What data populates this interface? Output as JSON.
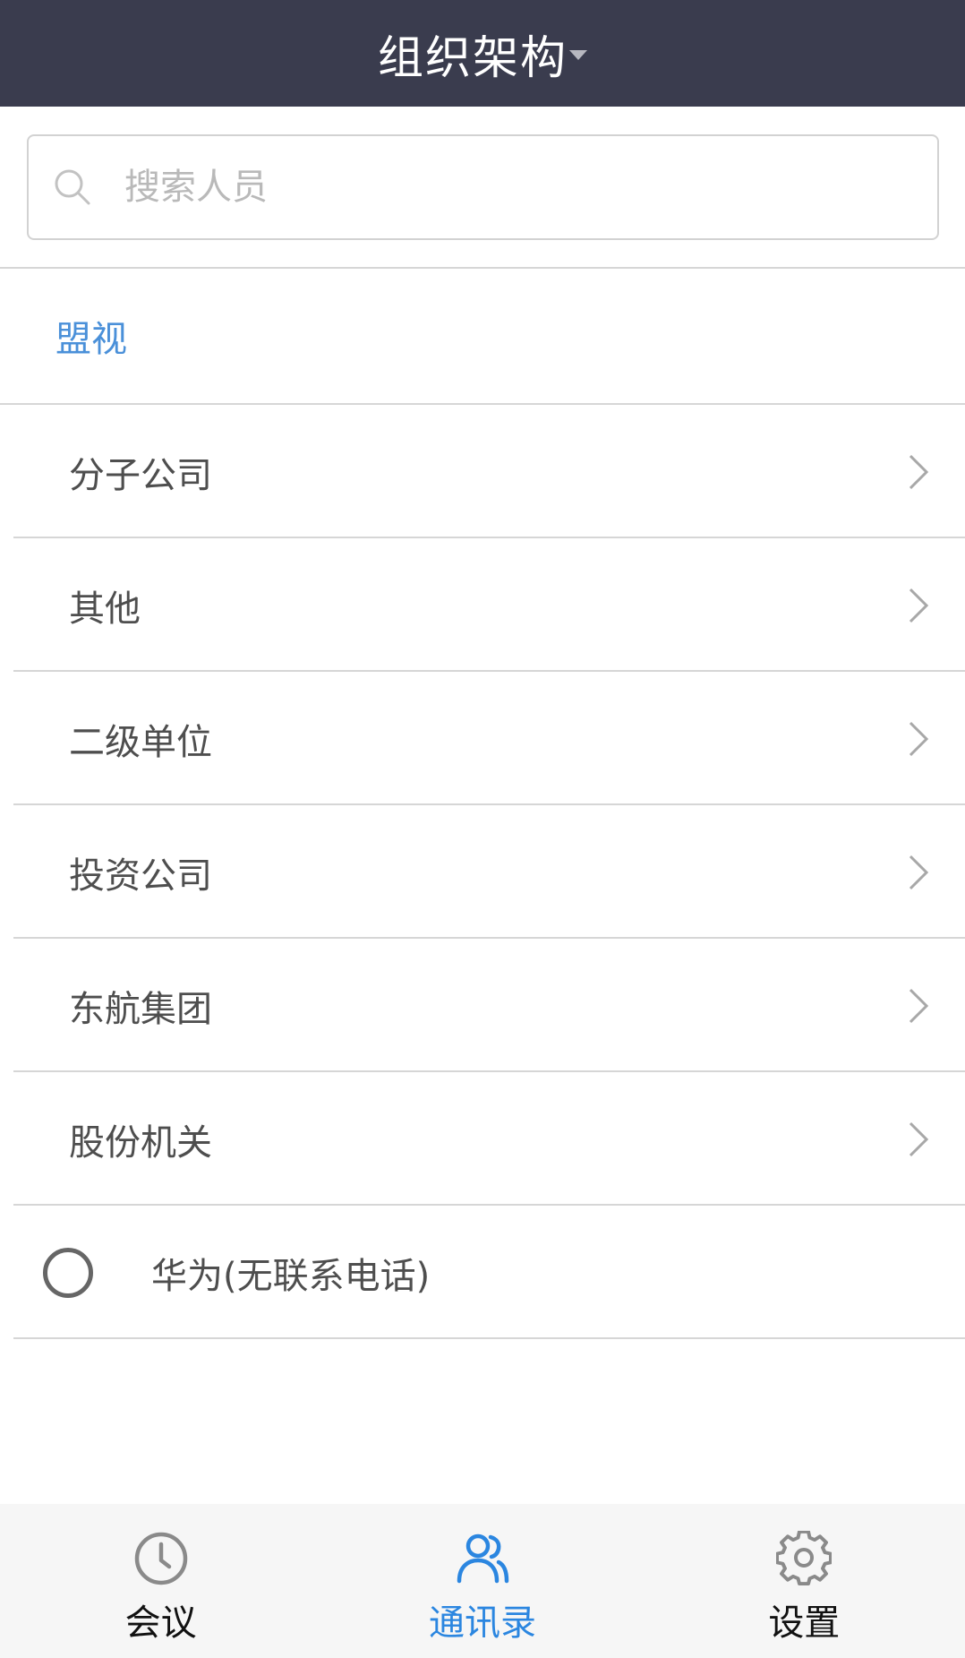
{
  "header": {
    "title": "组织架构"
  },
  "search": {
    "placeholder": "搜索人员"
  },
  "org_root": {
    "label": "盟视"
  },
  "departments": [
    {
      "label": "分子公司"
    },
    {
      "label": "其他"
    },
    {
      "label": "二级单位"
    },
    {
      "label": "投资公司"
    },
    {
      "label": "东航集团"
    },
    {
      "label": "股份机关"
    }
  ],
  "person": {
    "label": "华为(无联系电话)"
  },
  "tabs": [
    {
      "label": "会议",
      "icon": "clock-icon",
      "active": false
    },
    {
      "label": "通讯录",
      "icon": "contacts-icon",
      "active": true
    },
    {
      "label": "设置",
      "icon": "gear-icon",
      "active": false
    }
  ],
  "colors": {
    "header_bg": "#3a3c4e",
    "accent": "#2b86e0",
    "link_blue": "#4a90d9",
    "icon_gray": "#8a8a8a"
  }
}
